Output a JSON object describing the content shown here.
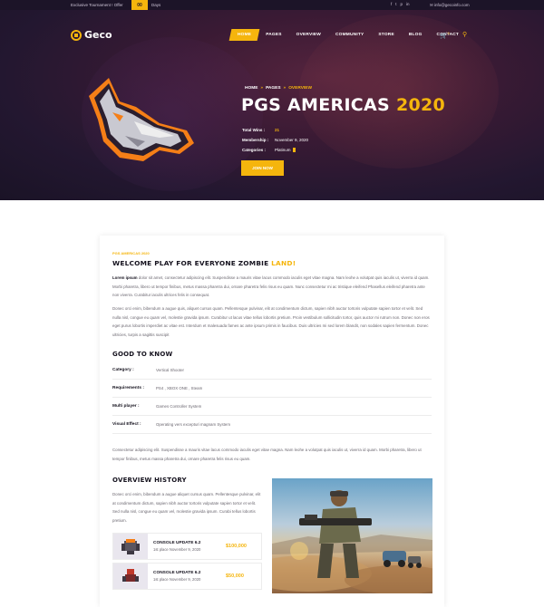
{
  "topbar": {
    "promo": "Exclusive Tournament ! Offer",
    "days_count": "00",
    "days_label": "Days",
    "social": [
      "f",
      "t",
      "p",
      "in"
    ],
    "email": "info@gecoinfo.com"
  },
  "nav": {
    "brand": "Geco",
    "menu": [
      {
        "label": "HOME",
        "active": true
      },
      {
        "label": "PAGES",
        "active": false
      },
      {
        "label": "OVERVIEW",
        "active": false
      },
      {
        "label": "COMMUNITY",
        "active": false
      },
      {
        "label": "STORE",
        "active": false
      },
      {
        "label": "BLOG",
        "active": false
      },
      {
        "label": "CONTACT",
        "active": false
      }
    ],
    "cart_count": "0"
  },
  "hero": {
    "breadcrumb": [
      "HOME",
      "PAGES",
      "OVERVIEW"
    ],
    "title_main": "PGS AMERICAS",
    "title_year": "2020",
    "meta": [
      {
        "label": "Total Wins :",
        "value": "21"
      },
      {
        "label": "Membership :",
        "value": "November 9, 2020"
      },
      {
        "label": "Categories :",
        "value": "Platinum"
      }
    ],
    "join_label": "JOIN NOW"
  },
  "content": {
    "kicker": "PGS AMERICAS 2020",
    "heading_main": "WELCOME PLAY FOR EVERYONE ZOMBIE",
    "heading_highlight": "LAND!",
    "intro_bold": "Lorem ipsum",
    "intro_rest": " dolor sit amet, consectetur adipiscing elit. Suspendisse a mauris vitae lacus commodo iaculis eget vitae magna. Nam leohe a volutpat quis iaculis ut, viverra id quam. Morbi pharetra, libero ut tempor finibus, metus massa pharetra dui, ornare pharetra felis risus eu quam. Nunc consectetur mi ac tristique eleifend Phasellus eleifend pharetra ante non viverra. Curabitur iaculis ultrices felis in consequat.",
    "para2": "Donec orci enim, bibendum a augue quis, aliquet cursus quam. Pellentesque pulvinar, elit at condimentum dictum, sapien nibh auctor tortoris vulputate sapien tortor et velit. Sed nulla nisl, congue eu quam vel, molestie gravida ipsum. Curabitur ut lacus vitae tellus lobortis pretium. Proin vestibulum sollicitudin tortor, quis auctor mi rutrum non. Donec non eros eget purus lobortis imperdiet ac vitae est. Interdum et malesuada fames ac ante ipsum primis in faucibus. Duis ultricies mi sed lorem blandit, non sodales sapien fermentum. Donec ultricies, turpis a sagittis suscipit",
    "good_to_know": "GOOD TO KNOW",
    "specs": [
      {
        "label": "Category :",
        "value": "Vertical Shooter"
      },
      {
        "label": "Requirements :",
        "value": "PS4 , XBOX ONE , Steam"
      },
      {
        "label": "Multi player :",
        "value": "Games Controller System"
      },
      {
        "label": "Visual Effect :",
        "value": "Operating vers excepturi magnam System"
      }
    ],
    "para3": "Consectetur adipiscing elit. Suspendisse a mauris vitae lacus commodo iaculis eget vitae magna. Nam leohe a volutpat quis iaculis ut, viverra id quam. Morbi pharetra, libero ut tempor finibus, metus massa pharetra dui, ornare pharetra felis risus eu quam.",
    "overview_history": "OVERVIEW HISTORY",
    "para4": "Donec orci enim, bibendum a augue aliquet cursus quam. Pellentesque pulvinar, elit at condimentum dictum, sapien nibh auctor tortoris vulputate sapien tortor et velit. Sed nulla nisl, congue eu quam vel, molestie gravida ipsum. Curabi tellus lobortis pretium.",
    "history": [
      {
        "title": "CONSOLE UPDATE 6.2",
        "date": "1st place November 9, 2020",
        "price": "$100,000"
      },
      {
        "title": "CONSOLE UPDATE 6.2",
        "date": "1st place November 9, 2020",
        "price": "$50,000"
      }
    ]
  },
  "colors": {
    "accent": "#f5b50d",
    "hero_dark": "#231730",
    "heading": "#15121e"
  }
}
